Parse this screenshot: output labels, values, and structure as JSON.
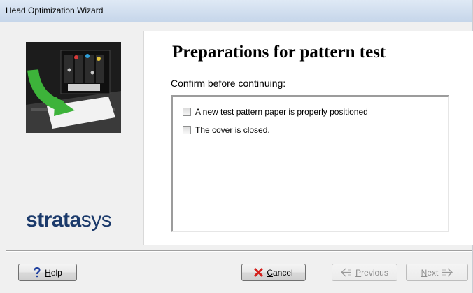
{
  "window": {
    "title": "Head Optimization Wizard"
  },
  "left_panel": {
    "image": "printer-head-positioning-illustration",
    "logo_bold": "strata",
    "logo_regular": "sys"
  },
  "main": {
    "heading": "Preparations for pattern test",
    "subheading": "Confirm before continuing:",
    "checklist": [
      {
        "label": "A new test pattern paper is properly positioned",
        "checked": false
      },
      {
        "label": "The cover is closed.",
        "checked": false
      }
    ]
  },
  "buttons": {
    "help": {
      "label": "Help",
      "underline": "H",
      "rest": "elp",
      "icon": "question-mark-icon",
      "enabled": true
    },
    "cancel": {
      "label": "Cancel",
      "underline": "C",
      "rest": "ancel",
      "icon": "red-x-icon",
      "enabled": true
    },
    "previous": {
      "label": "Previous",
      "underline": "P",
      "rest": "revious",
      "icon": "arrow-left-icon",
      "enabled": false
    },
    "next": {
      "label": "Next",
      "underline": "N",
      "rest": "ext",
      "icon": "arrow-right-icon",
      "enabled": false
    }
  },
  "colors": {
    "logo": "#1b3a6b",
    "arrow_green": "#3db33a",
    "cancel_x": "#d4201c",
    "help_icon": "#1f3f9e"
  }
}
